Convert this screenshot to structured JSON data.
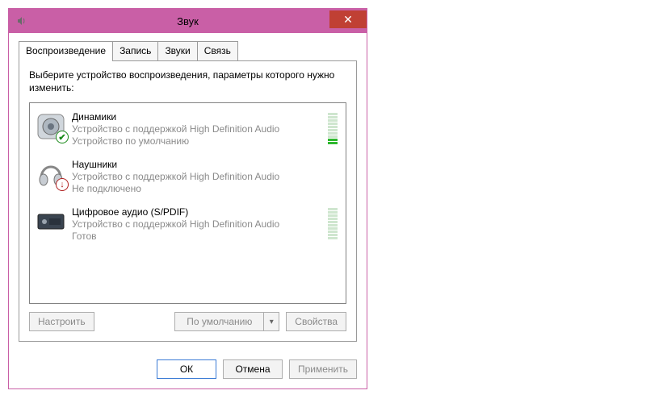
{
  "titlebar": {
    "title": "Звук",
    "close_glyph": "✕"
  },
  "tabs": [
    {
      "label": "Воспроизведение"
    },
    {
      "label": "Запись"
    },
    {
      "label": "Звуки"
    },
    {
      "label": "Связь"
    }
  ],
  "active_tab_index": 0,
  "instruction": "Выберите устройство воспроизведения, параметры которого нужно изменить:",
  "devices": [
    {
      "name": "Динамики",
      "subtitle": "Устройство с поддержкой High Definition Audio",
      "status": "Устройство по умолчанию",
      "badge": "ok",
      "level_segments": 10,
      "level_active": 2
    },
    {
      "name": "Наушники",
      "subtitle": "Устройство с поддержкой High Definition Audio",
      "status": "Не подключено",
      "badge": "down",
      "level_segments": 0,
      "level_active": 0
    },
    {
      "name": "Цифровое аудио (S/PDIF)",
      "subtitle": "Устройство с поддержкой High Definition Audio",
      "status": "Готов",
      "badge": "none",
      "level_segments": 10,
      "level_active": 0
    }
  ],
  "buttons": {
    "configure": "Настроить",
    "set_default": "По умолчанию",
    "properties": "Свойства",
    "ok": "ОК",
    "cancel": "Отмена",
    "apply": "Применить"
  }
}
